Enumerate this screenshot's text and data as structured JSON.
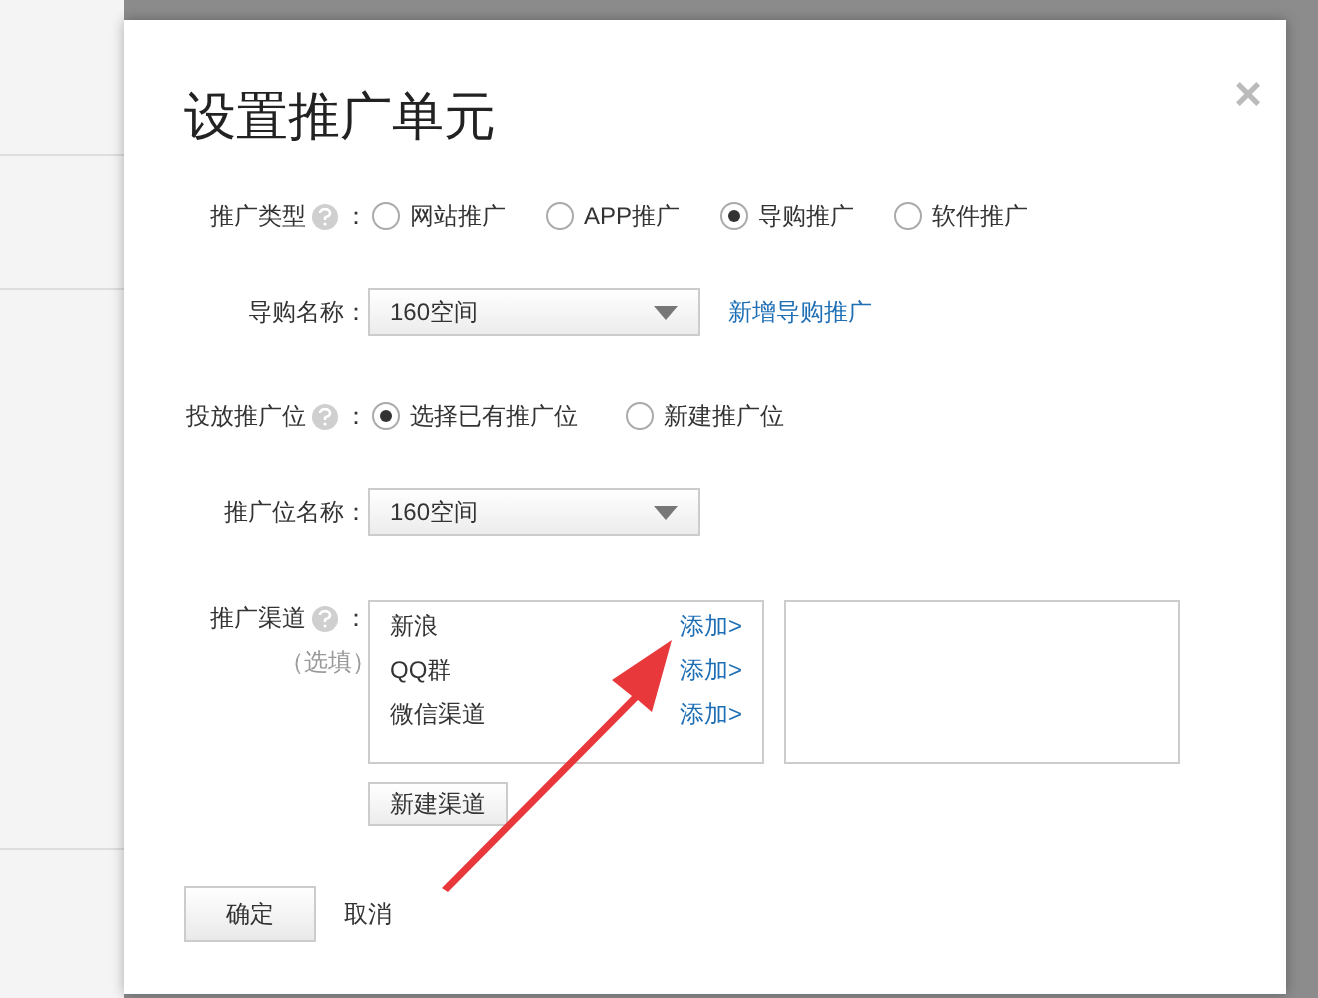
{
  "dialog": {
    "title": "设置推广单元",
    "close": "×"
  },
  "promo_type": {
    "label": "推广类型",
    "colon": "：",
    "options": [
      {
        "label": "网站推广",
        "selected": false
      },
      {
        "label": "APP推广",
        "selected": false
      },
      {
        "label": "导购推广",
        "selected": true
      },
      {
        "label": "软件推广",
        "selected": false
      }
    ]
  },
  "guide_name": {
    "label": "导购名称：",
    "value": "160空间",
    "link": "新增导购推广"
  },
  "placement": {
    "label": "投放推广位",
    "colon": "：",
    "options": [
      {
        "label": "选择已有推广位",
        "selected": true
      },
      {
        "label": "新建推广位",
        "selected": false
      }
    ]
  },
  "slot_name": {
    "label": "推广位名称：",
    "value": "160空间"
  },
  "channels": {
    "label": "推广渠道",
    "colon": "：",
    "note": "（选填）",
    "items": [
      {
        "name": "新浪",
        "action": "添加>"
      },
      {
        "name": "QQ群",
        "action": "添加>"
      },
      {
        "name": "微信渠道",
        "action": "添加>"
      }
    ],
    "new_button": "新建渠道"
  },
  "buttons": {
    "confirm": "确定",
    "cancel": "取消"
  }
}
